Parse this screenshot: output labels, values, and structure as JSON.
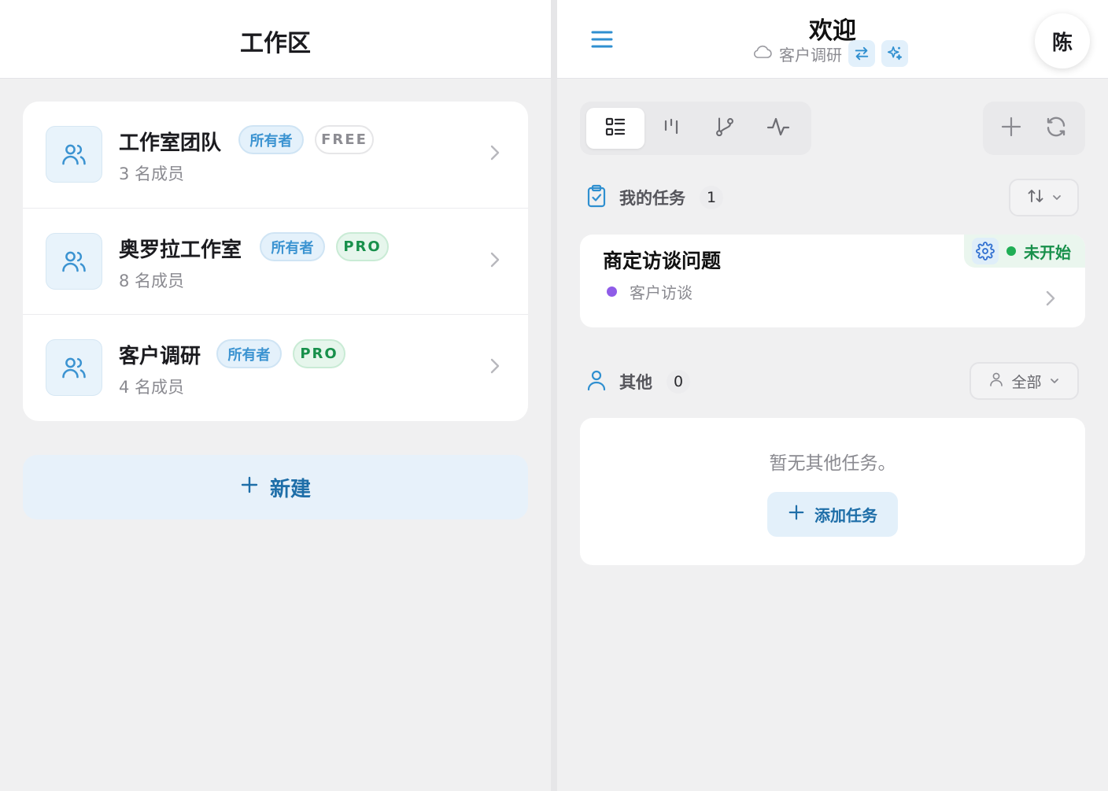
{
  "left": {
    "title": "工作区",
    "workspaces": [
      {
        "name": "工作室团队",
        "role": "所有者",
        "plan": "FREE",
        "members": "3 名成员"
      },
      {
        "name": "奥罗拉工作室",
        "role": "所有者",
        "plan": "PRO",
        "members": "8 名成员"
      },
      {
        "name": "客户调研",
        "role": "所有者",
        "plan": "PRO",
        "members": "4 名成员"
      }
    ],
    "new_button": "新建"
  },
  "right": {
    "title": "欢迎",
    "workspace_name": "客户调研",
    "avatar_initial": "陈",
    "my_tasks": {
      "label": "我的任务",
      "count": "1"
    },
    "task": {
      "title": "商定访谈问题",
      "category": "客户访谈",
      "status": "未开始"
    },
    "others": {
      "label": "其他",
      "count": "0",
      "filter": "全部"
    },
    "empty_text": "暂无其他任务。",
    "add_task_button": "添加任务"
  },
  "colors": {
    "accent": "#3b93d1",
    "pro_green": "#18904b",
    "status_green": "#1fae55",
    "category_purple": "#8f5ce8"
  }
}
